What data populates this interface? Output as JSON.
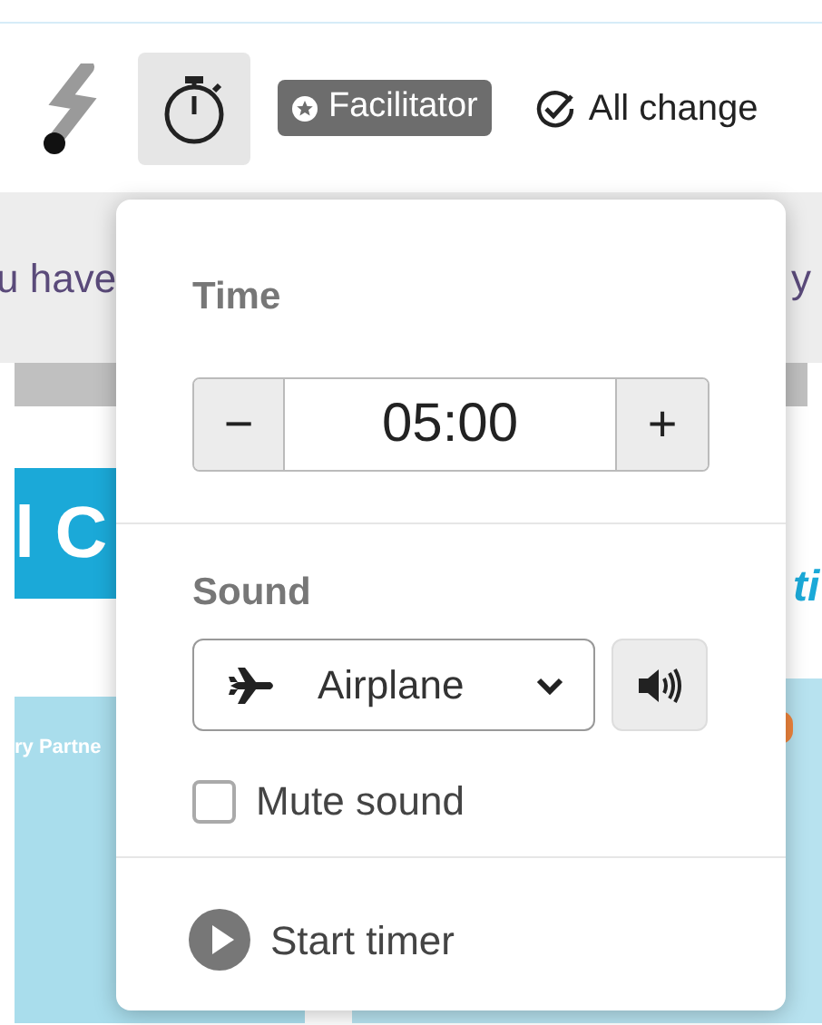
{
  "toolbar": {
    "timer_selected": true,
    "role_badge": "Facilitator",
    "save_status": "All change"
  },
  "background": {
    "notice_left": "u have",
    "notice_right": "y",
    "banner_text": "l C",
    "heading_right": "ti",
    "card_title": "ry Partne"
  },
  "timer_popover": {
    "time_label": "Time",
    "decrement": "−",
    "time_value": "05:00",
    "increment": "+",
    "sound_label": "Sound",
    "sound_choice": "Airplane",
    "mute": {
      "label": "Mute sound",
      "checked": false
    },
    "start": "Start timer"
  }
}
